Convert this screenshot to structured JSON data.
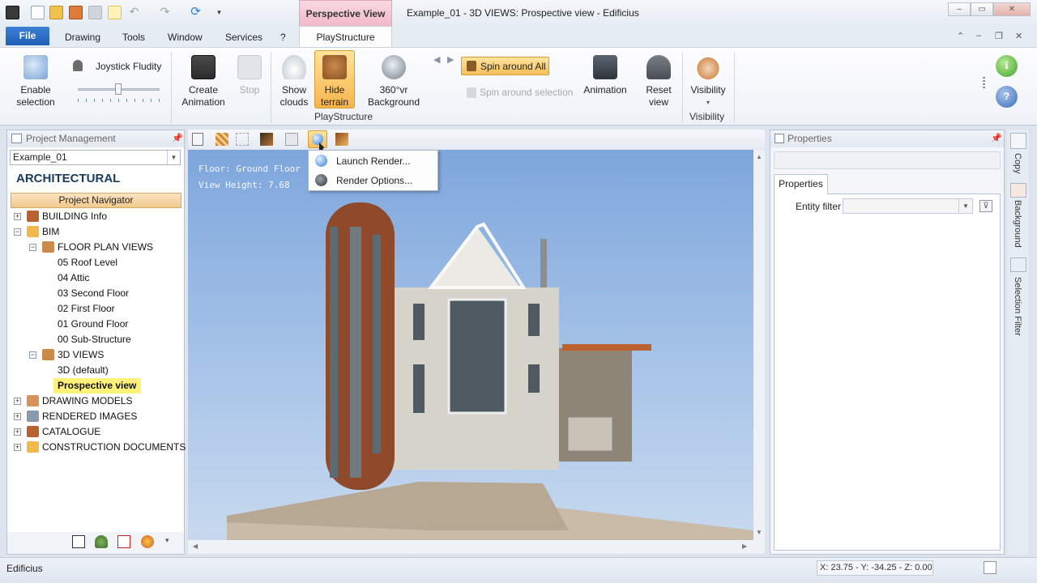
{
  "titlebar": {
    "context_tab": "Perspective View",
    "window_title": "Example_01 -  3D VIEWS: Prospective view - Edificius"
  },
  "menu": {
    "file": "File",
    "items": [
      "Drawing",
      "Tools",
      "Window",
      "Services",
      "?"
    ],
    "active_tab": "PlayStructure"
  },
  "ribbon": {
    "enable_selection": [
      "Enable",
      "selection"
    ],
    "joystick_fluidity": "Joystick Fludity",
    "create_animation": [
      "Create",
      "Animation"
    ],
    "stop": "Stop",
    "show_clouds": [
      "Show",
      "clouds"
    ],
    "hide_terrain": [
      "Hide",
      "terrain"
    ],
    "background_360": [
      "360°vr",
      "Background"
    ],
    "spin_around_all": "Spin around All",
    "spin_around_selection": "Spin around selection",
    "animation": "Animation",
    "reset_view": [
      "Reset",
      "view"
    ],
    "visibility": "Visibility",
    "group_playstructure": "PlayStructure",
    "group_visibility": "Visibility"
  },
  "sidebar": {
    "title": "Project Management",
    "project": "Example_01",
    "section": "ARCHITECTURAL",
    "navigator": "Project Navigator",
    "tree": [
      {
        "label": "BUILDING Info",
        "indent": 0,
        "toggle": "+"
      },
      {
        "label": "BIM",
        "indent": 0,
        "toggle": "−"
      },
      {
        "label": "FLOOR PLAN VIEWS",
        "indent": 1,
        "toggle": "−"
      },
      {
        "label": "05 Roof Level",
        "indent": 2
      },
      {
        "label": "04 Attic",
        "indent": 2
      },
      {
        "label": "03 Second Floor",
        "indent": 2
      },
      {
        "label": "02 First Floor",
        "indent": 2
      },
      {
        "label": "01 Ground Floor",
        "indent": 2
      },
      {
        "label": "00 Sub-Structure",
        "indent": 2
      },
      {
        "label": "3D VIEWS",
        "indent": 1,
        "toggle": "−"
      },
      {
        "label": "3D (default)",
        "indent": 2
      },
      {
        "label": "Prospective view",
        "indent": 2,
        "selected": true
      },
      {
        "label": "DRAWING MODELS",
        "indent": 0,
        "toggle": "+"
      },
      {
        "label": "RENDERED IMAGES",
        "indent": 0,
        "toggle": "+"
      },
      {
        "label": "CATALOGUE",
        "indent": 0,
        "toggle": "+"
      },
      {
        "label": "CONSTRUCTION DOCUMENTS SET",
        "indent": 0,
        "toggle": "+"
      }
    ]
  },
  "viewport": {
    "floor": "Floor: Ground Floor",
    "view_height": "View Height: 7.68"
  },
  "render_menu": {
    "launch": "Launch Render...",
    "options": "Render Options..."
  },
  "properties": {
    "title": "Properties",
    "tab": "Properties",
    "entity_filter": "Entity filter"
  },
  "right_tabs": [
    "Copy",
    "Background",
    "Selection Filter"
  ],
  "statusbar": {
    "app": "Edificius",
    "coords": "X: 23.75 - Y: -34.25 - Z: 0.00"
  },
  "colors": {
    "accent": "#1f5fb6",
    "context_tab": "#f0b8c8",
    "highlight_button": "#f9c46b",
    "selection": "#fff27a",
    "navigator": "#f3c98c"
  }
}
